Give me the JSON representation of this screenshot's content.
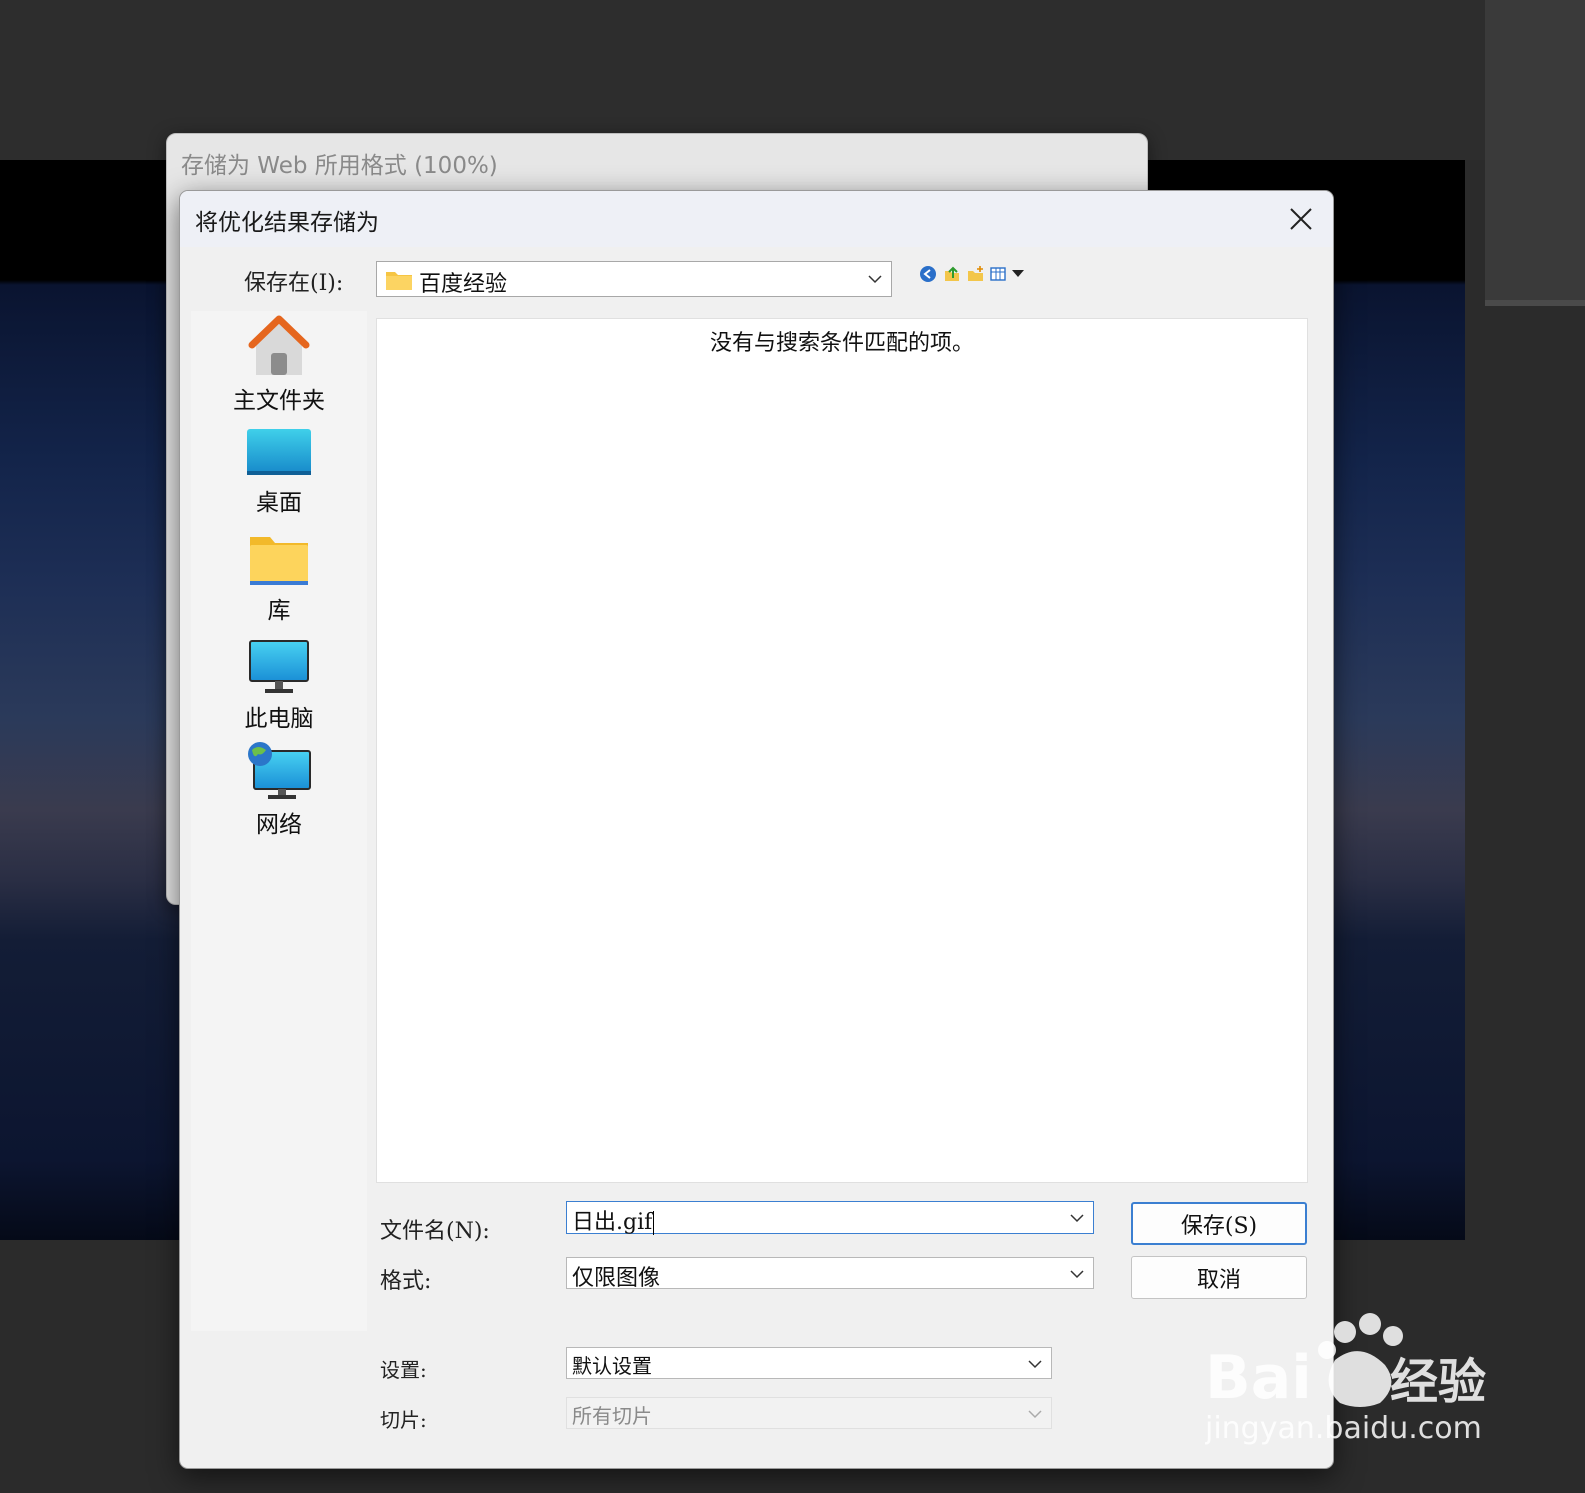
{
  "parent_window": {
    "title": "存储为 Web 所用格式 (100%)"
  },
  "dialog": {
    "title": "将优化结果存储为",
    "look_in_label": "保存在(I):",
    "look_in_value": "百度经验",
    "toolbar": [
      "back-icon",
      "up-folder-icon",
      "new-folder-icon",
      "view-menu-icon"
    ],
    "places": [
      {
        "label": "主文件夹",
        "icon": "home-icon"
      },
      {
        "label": "桌面",
        "icon": "desktop-icon"
      },
      {
        "label": "库",
        "icon": "library-folder-icon"
      },
      {
        "label": "此电脑",
        "icon": "computer-icon"
      },
      {
        "label": "网络",
        "icon": "network-icon"
      }
    ],
    "empty_message": "没有与搜索条件匹配的项。",
    "filename_label": "文件名(N):",
    "filename_value": "日出.gif",
    "format_label": "格式:",
    "format_value": "仅限图像",
    "settings_label": "设置:",
    "settings_value": "默认设置",
    "slices_label": "切片:",
    "slices_value": "所有切片",
    "save_label": "保存(S)",
    "cancel_label": "取消"
  },
  "watermark": {
    "brand": "Bai经验",
    "url": "jingyan.baidu.com"
  },
  "colors": {
    "accent": "#3b7fd1",
    "dialog_bg": "#f0f0f0",
    "titlebar_bg": "#eef0f6"
  }
}
